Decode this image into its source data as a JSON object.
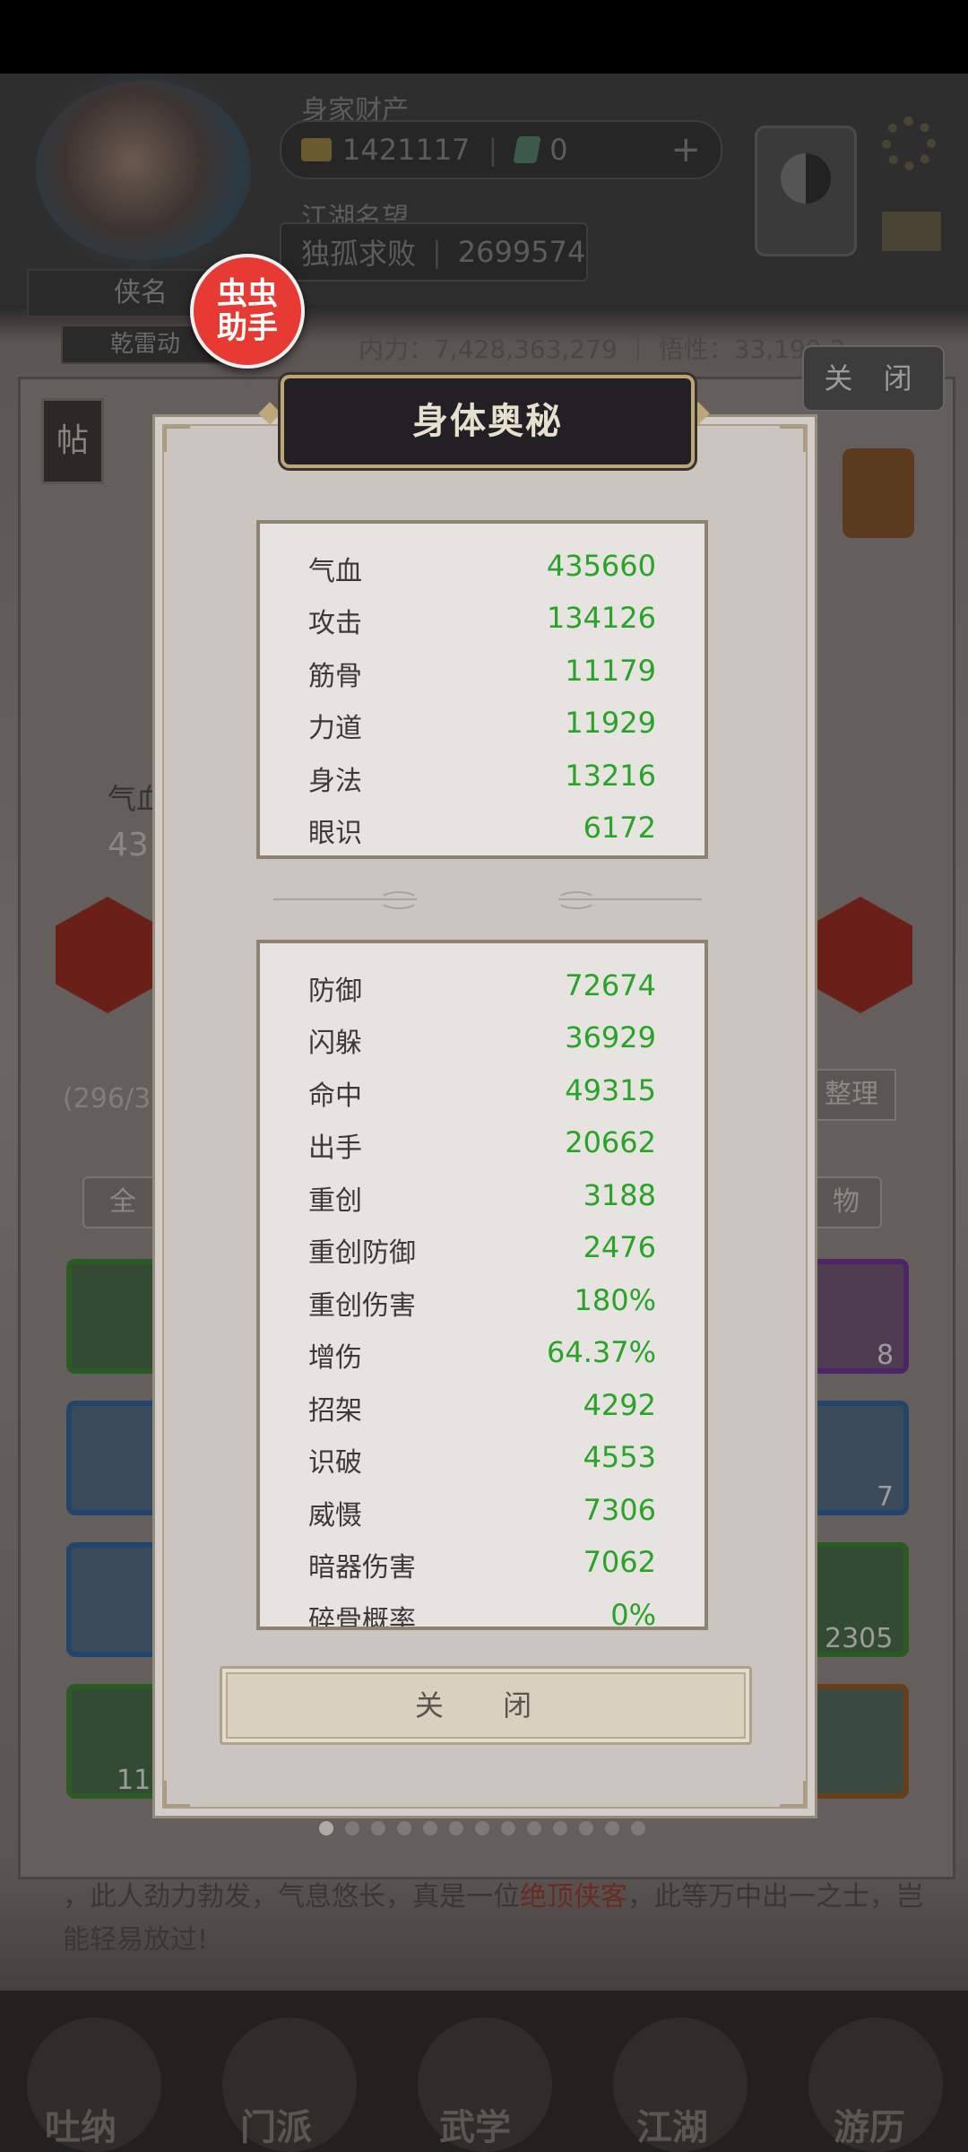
{
  "header": {
    "wealth_label": "身家财产",
    "gold_value": "1421117",
    "jade_value": "0",
    "plus_symbol": "+",
    "fame_label": "江湖名望",
    "fame_title": "独孤求败",
    "fame_value": "2699574",
    "name_plate": "侠名",
    "sub_plate": "乾雷动",
    "neili_line": "内力：7,428,363,279 ｜ 悟性：33,199,2"
  },
  "badge": {
    "line1": "虫虫",
    "line2": "助手"
  },
  "background": {
    "close_label": "关 闭",
    "tie_label": "帖",
    "left_stat_label": "气血",
    "left_stat_value": "43",
    "bag_count": "(296/3",
    "arrange_label": "整理",
    "tab_all": "全",
    "tab_items": "物",
    "slot_counts": [
      "8",
      "7",
      "2305",
      "11"
    ],
    "bottom_text_a": "，此人劲力勃发，气息悠长，真是一位",
    "bottom_text_red": "绝顶侠客",
    "bottom_text_b": "，此等万中出一之士，岂能轻易放过!",
    "nav": [
      "吐纳",
      "门派",
      "武学",
      "江湖",
      "游历"
    ]
  },
  "modal": {
    "title": "身体奥秘",
    "close_label": "关 闭",
    "stats_primary": [
      {
        "name": "气血",
        "value": "435660"
      },
      {
        "name": "攻击",
        "value": "134126"
      },
      {
        "name": "筋骨",
        "value": "11179"
      },
      {
        "name": "力道",
        "value": "11929"
      },
      {
        "name": "身法",
        "value": "13216"
      },
      {
        "name": "眼识",
        "value": "6172"
      }
    ],
    "stats_secondary": [
      {
        "name": "防御",
        "value": "72674"
      },
      {
        "name": "闪躲",
        "value": "36929"
      },
      {
        "name": "命中",
        "value": "49315"
      },
      {
        "name": "出手",
        "value": "20662"
      },
      {
        "name": "重创",
        "value": "3188"
      },
      {
        "name": "重创防御",
        "value": "2476"
      },
      {
        "name": "重创伤害",
        "value": "180%"
      },
      {
        "name": "增伤",
        "value": "64.37%"
      },
      {
        "name": "招架",
        "value": "4292"
      },
      {
        "name": "识破",
        "value": "4553"
      },
      {
        "name": "威慑",
        "value": "7306"
      },
      {
        "name": "暗器伤害",
        "value": "7062"
      },
      {
        "name": "碎骨概率",
        "value": "0%"
      }
    ]
  },
  "colors": {
    "stat_value": "#2aa329",
    "badge": "#e73a33",
    "title_bar": "#222024"
  }
}
